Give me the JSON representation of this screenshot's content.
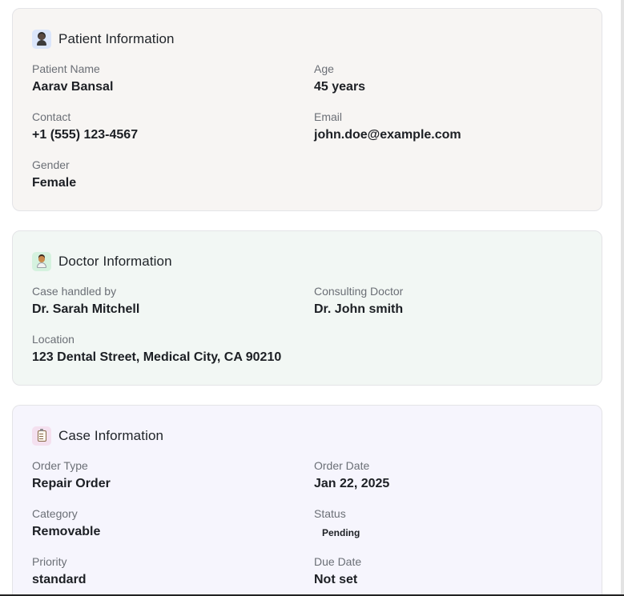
{
  "patient_card": {
    "title": "Patient Information",
    "icon": "patient-icon",
    "fields": [
      {
        "label": "Patient Name",
        "value": "Aarav Bansal"
      },
      {
        "label": "Age",
        "value": "45 years"
      },
      {
        "label": "Contact",
        "value": "+1 (555) 123-4567"
      },
      {
        "label": "Email",
        "value": "john.doe@example.com"
      },
      {
        "label": "Gender",
        "value": "Female"
      }
    ]
  },
  "doctor_card": {
    "title": "Doctor Information",
    "icon": "doctor-icon",
    "fields": [
      {
        "label": "Case handled by",
        "value": "Dr. Sarah Mitchell"
      },
      {
        "label": "Consulting Doctor",
        "value": "Dr. John smith"
      },
      {
        "label": "Location",
        "value": "123 Dental Street, Medical City, CA 90210"
      }
    ]
  },
  "case_card": {
    "title": "Case Information",
    "icon": "clipboard-icon",
    "fields": [
      {
        "label": "Order Type",
        "value": "Repair Order"
      },
      {
        "label": "Order Date",
        "value": "Jan 22, 2025"
      },
      {
        "label": "Category",
        "value": "Removable"
      },
      {
        "label": "Status",
        "value": "Pending"
      },
      {
        "label": "Priority",
        "value": "standard"
      },
      {
        "label": "Due Date",
        "value": "Not set"
      }
    ]
  },
  "colors": {
    "patient_bg": "#f7f5f3",
    "doctor_bg": "#f2f7f4",
    "case_bg": "#f6f5fd",
    "label": "#6b6f76",
    "value": "#1c1f24"
  }
}
